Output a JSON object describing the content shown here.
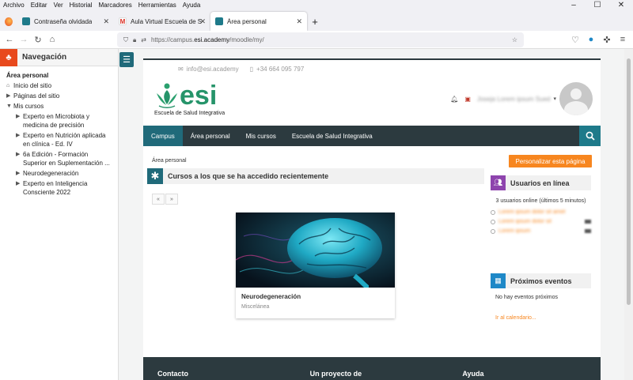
{
  "menubar": {
    "items": [
      "Archivo",
      "Editar",
      "Ver",
      "Historial",
      "Marcadores",
      "Herramientas",
      "Ayuda"
    ]
  },
  "tabs": [
    {
      "label": "Contraseña olvidada"
    },
    {
      "label": "Aula Virtual Escuela de Salud Int"
    },
    {
      "label": "Área personal"
    }
  ],
  "address": {
    "scheme": "https://campus.",
    "host": "esi.academy",
    "path": "/moodle/my/"
  },
  "sidebar": {
    "title": "Navegación",
    "section": "Área personal",
    "items": [
      {
        "label": "Inicio del sitio"
      },
      {
        "label": "Páginas del sitio"
      },
      {
        "label": "Mis cursos"
      },
      {
        "label": "Experto en Microbiota y medicina de precisión"
      },
      {
        "label": "Experto en Nutrición aplicada en clínica - Ed. IV"
      },
      {
        "label": "6a Edición - Formación Superior en Suplementación ..."
      },
      {
        "label": "Neurodegeneración"
      },
      {
        "label": "Experto en Inteligencia Consciente 2022"
      }
    ]
  },
  "header": {
    "email": "info@esi.academy",
    "phone": "+34 664 095 797",
    "logo_word": "esi",
    "logo_subtitle": "Escuela de Salud Integrativa",
    "user_name": "Joseja Lorem ipsum Sued"
  },
  "menu": {
    "items": [
      "Campus",
      "Área personal",
      "Mis cursos",
      "Escuela de Salud Integrativa"
    ]
  },
  "breadcrumb": "Área personal",
  "customize_label": "Personalizar esta página",
  "courses_block": {
    "title": "Cursos a los que se ha accedido recientemente",
    "prev": "«",
    "next": "»",
    "course": {
      "name": "Neurodegeneración",
      "category": "Miscelánea"
    }
  },
  "users_block": {
    "title": "Usuarios en línea",
    "info": "3 usuarios online (últimos 5 minutos)",
    "users": [
      "Lorem ipsum dolor sit amet",
      "Lorem ipsum dolor sit",
      "Lorem ipsum"
    ]
  },
  "events_block": {
    "title": "Próximos eventos",
    "none": "No hay eventos próximos",
    "calendar_link": "Ir al calendario..."
  },
  "footer": {
    "columns": [
      "Contacto",
      "Un proyecto de",
      "Ayuda"
    ]
  },
  "colors": {
    "teal": "#206a7a",
    "dark": "#2c3a3f",
    "orange": "#f7861f",
    "green": "#26946a",
    "purple": "#8e44ad",
    "blue": "#1e88c7"
  }
}
